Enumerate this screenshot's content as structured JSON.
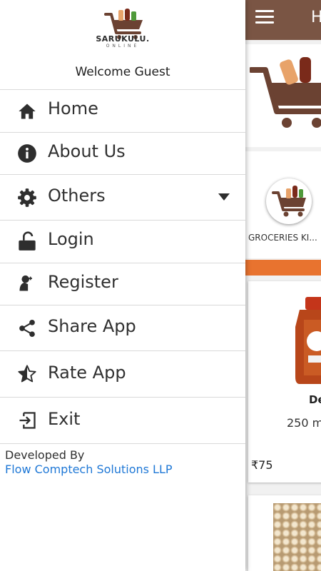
{
  "brand": {
    "name": "SARUKULU.",
    "subtitle": "ONLINE",
    "logo_icon": "shopping-cart-groceries-icon"
  },
  "drawer": {
    "welcome": "Welcome Guest",
    "items": [
      {
        "label": "Home",
        "icon": "home-icon"
      },
      {
        "label": "About Us",
        "icon": "info-icon"
      },
      {
        "label": "Others",
        "icon": "gear-icon",
        "expandable": true
      },
      {
        "label": "Login",
        "icon": "unlock-icon"
      },
      {
        "label": "Register",
        "icon": "add-user-icon"
      },
      {
        "label": "Share App",
        "icon": "share-icon"
      },
      {
        "label": "Rate App",
        "icon": "half-star-icon"
      },
      {
        "label": "Exit",
        "icon": "exit-icon"
      }
    ],
    "footer": {
      "developed_by": "Developed By",
      "company": "Flow Comptech Solutions LLP"
    }
  },
  "app": {
    "title_partial": "H",
    "category_label": "GROCERIES KI...",
    "product": {
      "name_partial": "De",
      "quantity_partial": "250 m",
      "price": "₹75"
    }
  },
  "colors": {
    "topbar": "#7a5544",
    "accent_orange": "#e8732f",
    "link_blue": "#1f78d6",
    "cart_brown": "#6b4232"
  }
}
